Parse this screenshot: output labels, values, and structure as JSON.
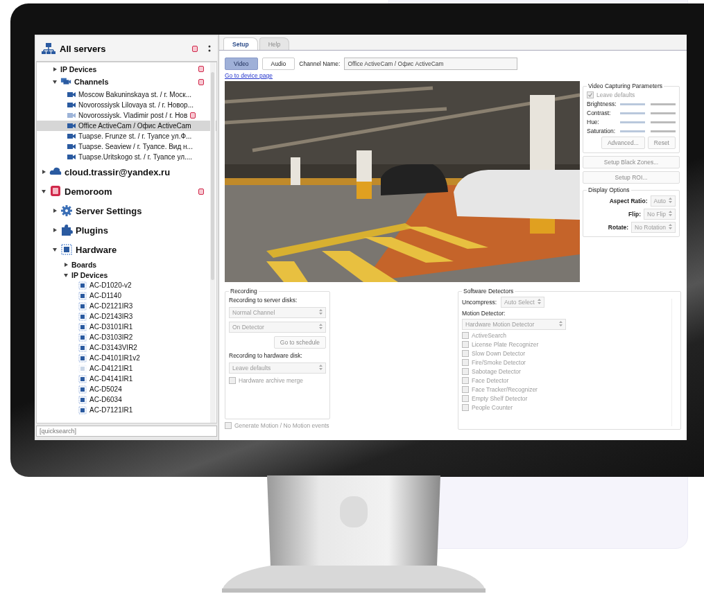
{
  "sidebar": {
    "title": "All servers",
    "alert": true,
    "tree": [
      {
        "kind": "hidden",
        "children": [
          {
            "label": "IP Devices",
            "kind": "folder",
            "expanded": false,
            "alert": true,
            "selected": false
          },
          {
            "label": "Channels",
            "kind": "channels",
            "expanded": true,
            "alert": true,
            "selected": false,
            "children": [
              {
                "label": "Moscow Bakuninskaya st. / г. Моск...",
                "kind": "camera",
                "active": true,
                "alert": false,
                "selected": false
              },
              {
                "label": "Novorossiysk Lilovaya st. / г. Новор...",
                "kind": "camera",
                "active": true,
                "alert": false,
                "selected": false
              },
              {
                "label": "Novorossiysk. Vladimir post / г. Нов",
                "kind": "camera",
                "active": false,
                "alert": true,
                "selected": false
              },
              {
                "label": "Office ActiveCam / Офис ActiveCam",
                "kind": "camera",
                "active": true,
                "alert": false,
                "selected": true
              },
              {
                "label": "Tuapse. Frunze st. / г. Туапсе ул.Ф...",
                "kind": "camera",
                "active": true,
                "alert": false,
                "selected": false
              },
              {
                "label": "Tuapse. Seaview / г. Туапсе. Вид н...",
                "kind": "camera",
                "active": true,
                "alert": false,
                "selected": false
              },
              {
                "label": "Tuapse.Uritskogo st. / г. Туапсе ул....",
                "kind": "camera",
                "active": true,
                "alert": false,
                "selected": false
              }
            ]
          }
        ]
      },
      {
        "label": "cloud.trassir@yandex.ru",
        "kind": "cloud",
        "expanded": false,
        "alert": false,
        "selected": false
      },
      {
        "label": "Demoroom",
        "kind": "server",
        "expanded": true,
        "alert": true,
        "selected": false,
        "children": [
          {
            "label": "Server Settings",
            "kind": "settings",
            "expanded": false,
            "alert": false,
            "selected": false
          },
          {
            "label": "Plugins",
            "kind": "plugins",
            "expanded": false,
            "alert": false,
            "selected": false
          },
          {
            "label": "Hardware",
            "kind": "hardware",
            "expanded": true,
            "alert": false,
            "selected": false,
            "children": [
              {
                "label": "Boards",
                "kind": "folder",
                "expanded": false,
                "alert": false,
                "selected": false
              },
              {
                "label": "IP Devices",
                "kind": "folder",
                "expanded": true,
                "alert": false,
                "selected": false,
                "children": [
                  {
                    "label": "AC-D1020-v2",
                    "kind": "device",
                    "active": true,
                    "alert": false,
                    "selected": false
                  },
                  {
                    "label": "AC-D1140",
                    "kind": "device",
                    "active": true,
                    "alert": false,
                    "selected": false
                  },
                  {
                    "label": "AC-D2121IR3",
                    "kind": "device",
                    "active": true,
                    "alert": false,
                    "selected": false
                  },
                  {
                    "label": "AC-D2143IR3",
                    "kind": "device",
                    "active": true,
                    "alert": false,
                    "selected": false
                  },
                  {
                    "label": "AC-D3101IR1",
                    "kind": "device",
                    "active": true,
                    "alert": false,
                    "selected": false
                  },
                  {
                    "label": "AC-D3103IR2",
                    "kind": "device",
                    "active": true,
                    "alert": false,
                    "selected": false
                  },
                  {
                    "label": "AC-D3143VIR2",
                    "kind": "device",
                    "active": true,
                    "alert": false,
                    "selected": false
                  },
                  {
                    "label": "AC-D4101IR1v2",
                    "kind": "device",
                    "active": true,
                    "alert": false,
                    "selected": false
                  },
                  {
                    "label": "AC-D4121IR1",
                    "kind": "device",
                    "active": false,
                    "alert": false,
                    "selected": false
                  },
                  {
                    "label": "AC-D4141IR1",
                    "kind": "device",
                    "active": true,
                    "alert": false,
                    "selected": false
                  },
                  {
                    "label": "AC-D5024",
                    "kind": "device",
                    "active": true,
                    "alert": false,
                    "selected": false
                  },
                  {
                    "label": "AC-D6034",
                    "kind": "device",
                    "active": true,
                    "alert": false,
                    "selected": false
                  },
                  {
                    "label": "AC-D7121IR1",
                    "kind": "device",
                    "active": true,
                    "alert": false,
                    "selected": false
                  }
                ]
              }
            ]
          }
        ]
      }
    ],
    "search": {
      "placeholder": "[quicksearch]"
    }
  },
  "tabs": [
    {
      "label": "Setup",
      "selected": true
    },
    {
      "label": "Help",
      "selected": false
    }
  ],
  "stream_buttons": [
    {
      "label": "Video",
      "selected": true
    },
    {
      "label": "Audio",
      "selected": false
    }
  ],
  "channel_name": {
    "label": "Channel Name:",
    "value": "Office ActiveCam / Офис ActiveCam"
  },
  "device_link": "Go to device page",
  "video_capturing": {
    "title": "Video Capturing Parameters",
    "leave_defaults": {
      "label": "Leave defaults",
      "checked": true
    },
    "sliders": [
      {
        "label": "Brightness:",
        "level": 0.5
      },
      {
        "label": "Contrast:",
        "level": 0.5
      },
      {
        "label": "Hue:",
        "level": 0.5
      },
      {
        "label": "Saturation:",
        "level": 0.5
      }
    ],
    "buttons": [
      "Advanced...",
      "Reset"
    ]
  },
  "side_buttons": [
    "Setup Black Zones...",
    "Setup ROI..."
  ],
  "display_options": {
    "title": "Display Options",
    "fields": [
      {
        "label": "Aspect Ratio:",
        "value": "Auto"
      },
      {
        "label": "Flip:",
        "value": "No Flip"
      },
      {
        "label": "Rotate:",
        "value": "No Rotation"
      }
    ]
  },
  "recording": {
    "title": "Recording",
    "server_label": "Recording to server disks:",
    "server_selects": [
      "Normal Channel",
      "On Detector"
    ],
    "schedule_button": "Go to schedule",
    "hardware_label": "Recording to hardware disk:",
    "hardware_select": "Leave defaults",
    "archive_merge": {
      "label": "Hardware archive merge",
      "checked": false
    }
  },
  "motion_events": {
    "label": "Generate Motion / No Motion events",
    "checked": false
  },
  "software_detectors": {
    "title": "Software Detectors",
    "uncompress_label": "Uncompress:",
    "uncompress_value": "Auto Select",
    "motion_label": "Motion Detector:",
    "motion_value": "Hardware Motion Detector",
    "detectors": [
      {
        "label": "ActiveSearch",
        "checked": false
      },
      {
        "label": "License Plate Recognizer",
        "checked": false
      },
      {
        "label": "Slow Down Detector",
        "checked": false
      },
      {
        "label": "Fire/Smoke Detector",
        "checked": false
      },
      {
        "label": "Sabotage Detector",
        "checked": false
      },
      {
        "label": "Face Detector",
        "checked": false
      },
      {
        "label": "Face Tracker/Recognizer",
        "checked": false
      },
      {
        "label": "Empty Shelf Detector",
        "checked": false
      },
      {
        "label": "People Counter",
        "checked": false
      }
    ]
  }
}
